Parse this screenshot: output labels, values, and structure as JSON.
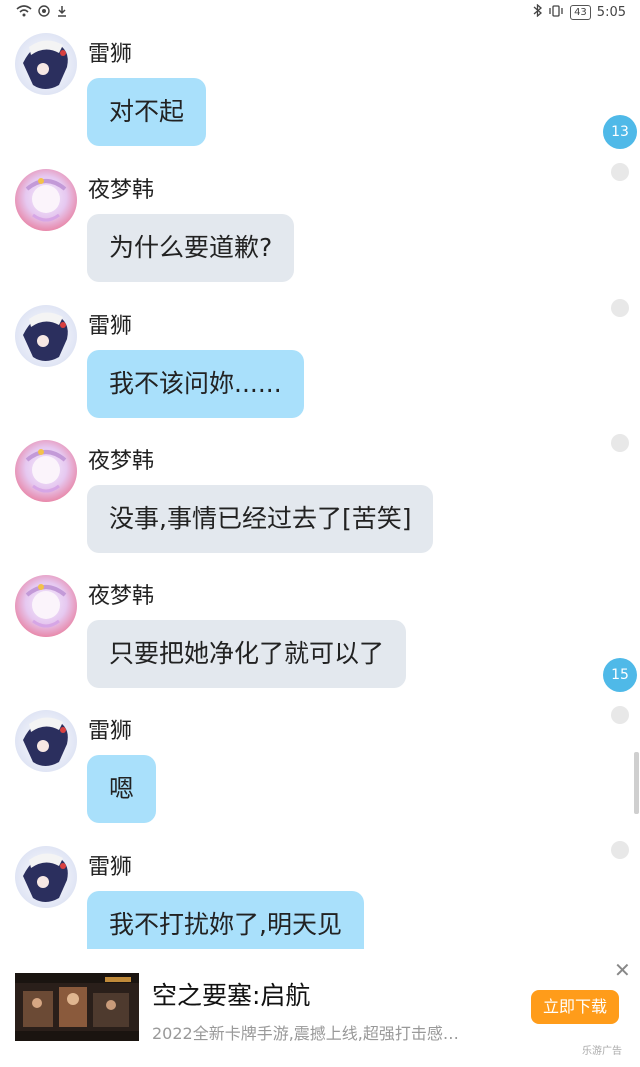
{
  "status_bar": {
    "time": "5:05",
    "battery": "43"
  },
  "messages": [
    {
      "sender": "雷狮",
      "text": "对不起",
      "style": "blue",
      "avatar": "leishi"
    },
    {
      "sender": "夜梦韩",
      "text": "为什么要道歉?",
      "style": "gray",
      "avatar": "yemenghan"
    },
    {
      "sender": "雷狮",
      "text": "我不该问妳......",
      "style": "blue",
      "avatar": "leishi"
    },
    {
      "sender": "夜梦韩",
      "text": "没事,事情已经过去了[苦笑]",
      "style": "gray",
      "avatar": "yemenghan"
    },
    {
      "sender": "夜梦韩",
      "text": "只要把她净化了就可以了",
      "style": "gray",
      "avatar": "yemenghan"
    },
    {
      "sender": "雷狮",
      "text": "嗯",
      "style": "blue",
      "avatar": "leishi"
    },
    {
      "sender": "雷狮",
      "text": "我不打扰妳了,明天见",
      "style": "blue",
      "avatar": "leishi"
    }
  ],
  "unread_badges": [
    "13",
    "15"
  ],
  "ad": {
    "title": "空之要塞:启航",
    "description": "2022全新卡牌手游,震撼上线,超强打击感…",
    "cta": "立即下载",
    "source": "乐游广告",
    "close": "✕"
  },
  "colors": {
    "blue_bubble": "#a9e0fb",
    "gray_bubble": "#e3e8ee",
    "badge": "#4fb9e8",
    "cta": "#ff9c1a"
  }
}
